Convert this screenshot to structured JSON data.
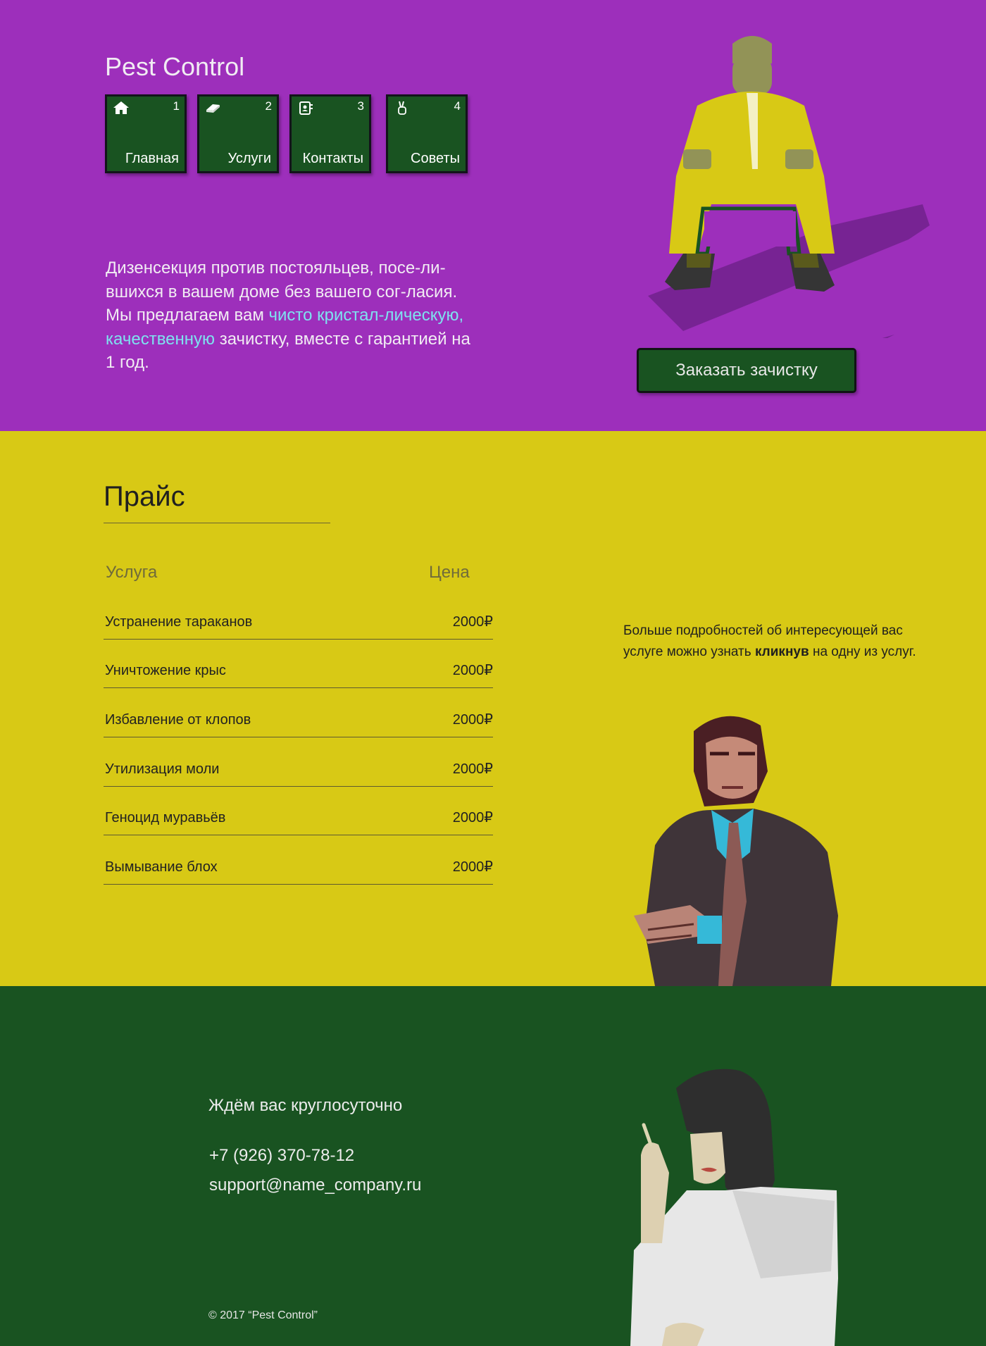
{
  "header": {
    "logo": "Pest Control"
  },
  "nav": {
    "items": [
      {
        "num": "1",
        "label": "Главная",
        "icon": "home-icon"
      },
      {
        "num": "2",
        "label": "Услуги",
        "icon": "book-icon"
      },
      {
        "num": "3",
        "label": "Контакты",
        "icon": "contacts-icon"
      },
      {
        "num": "4",
        "label": "Советы",
        "icon": "peace-hand-icon"
      }
    ]
  },
  "hero": {
    "text_before": "Дизенсекция против постояльцев, посе-ли­вшихся в вашем доме без вашего сог-ласия. Мы предлагаем вам ",
    "text_highlight": "чисто кристал-лическую, качественную",
    "text_after": " зачистку, вместе с гарантией на 1 год.",
    "order_button": "Заказать зачистку"
  },
  "price": {
    "title": "Прайс",
    "col_service": "Услуга",
    "col_price": "Цена",
    "rows": [
      {
        "service": "Устранение тараканов",
        "price": "2000₽"
      },
      {
        "service": "Уничтожение крыс",
        "price": "2000₽"
      },
      {
        "service": "Избавление от клопов",
        "price": "2000₽"
      },
      {
        "service": "Утилизация моли",
        "price": "2000₽"
      },
      {
        "service": "Геноцид муравьёв",
        "price": "2000₽"
      },
      {
        "service": "Вымывание блох",
        "price": "2000₽"
      }
    ],
    "info_before": "Больше подробностей об интересующей вас услуге можно узнать ",
    "info_bold": "кликнув",
    "info_after": " на одну из услуг."
  },
  "footer": {
    "wait": "Ждём вас круглосуточно",
    "phone": "+7 (926) 370-78-12",
    "email": "support@name_company.ru",
    "copyright": "© 2017 “Pest Control”"
  },
  "colors": {
    "hero_bg": "#9d2fbb",
    "price_bg": "#d8c915",
    "footer_bg": "#195321",
    "tile_bg": "#195321",
    "highlight": "#7ee2ef"
  }
}
